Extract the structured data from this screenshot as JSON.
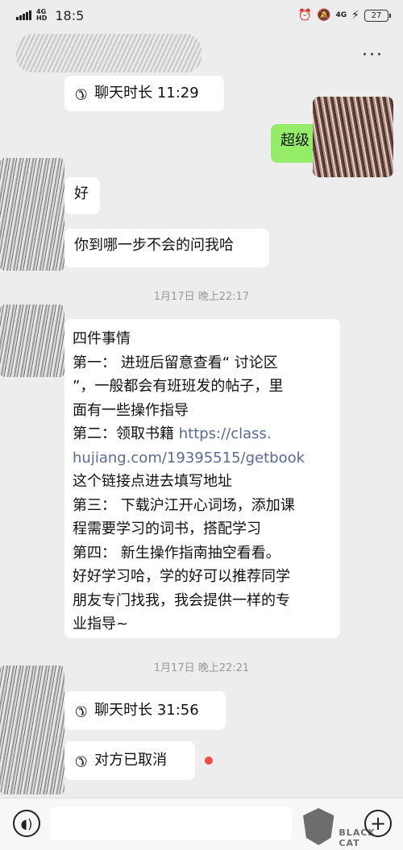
{
  "status_bar": {
    "network_left": "4G",
    "network_left_sub": "HD",
    "time": "18:5",
    "network_right": "4G",
    "battery": "27"
  },
  "messages": {
    "call1": {
      "label": "聊天时长 11:29"
    },
    "me1": {
      "text": "超级"
    },
    "them1": {
      "text": "好"
    },
    "them2": {
      "text": "你到哪一步不会的问我哈"
    },
    "ts1": "1月17日 晚上22:17",
    "long": {
      "lines": [
        "四件事情",
        "第一： 进班后留意查看“ 讨论区",
        "”，一般都会有班班发的帖子，里",
        "面有一些操作指导",
        "第二：领取书籍 ",
        "hujiang.com/19395515/getbook",
        "这个链接点进去填写地址",
        "第三： 下载沪江开心词场，添加课",
        "程需要学习的词书，搭配学习",
        "第四： 新生操作指南抽空看看。",
        "好好学习哈，学的好可以推荐同学",
        "朋友专门找我，我会提供一样的专",
        "业指导~"
      ],
      "link_part1": "https://class."
    },
    "ts2": "1月17日 晚上22:21",
    "call2": {
      "label": "聊天时长 31:56"
    },
    "call3": {
      "label": "对方已取消"
    }
  },
  "watermark": {
    "text": "BLACK CAT"
  },
  "colors": {
    "background": "#ededed",
    "bubble_me": "#95ec69",
    "bubble_other": "#ffffff",
    "link": "#576b95",
    "unread_dot": "#f04a4a"
  }
}
